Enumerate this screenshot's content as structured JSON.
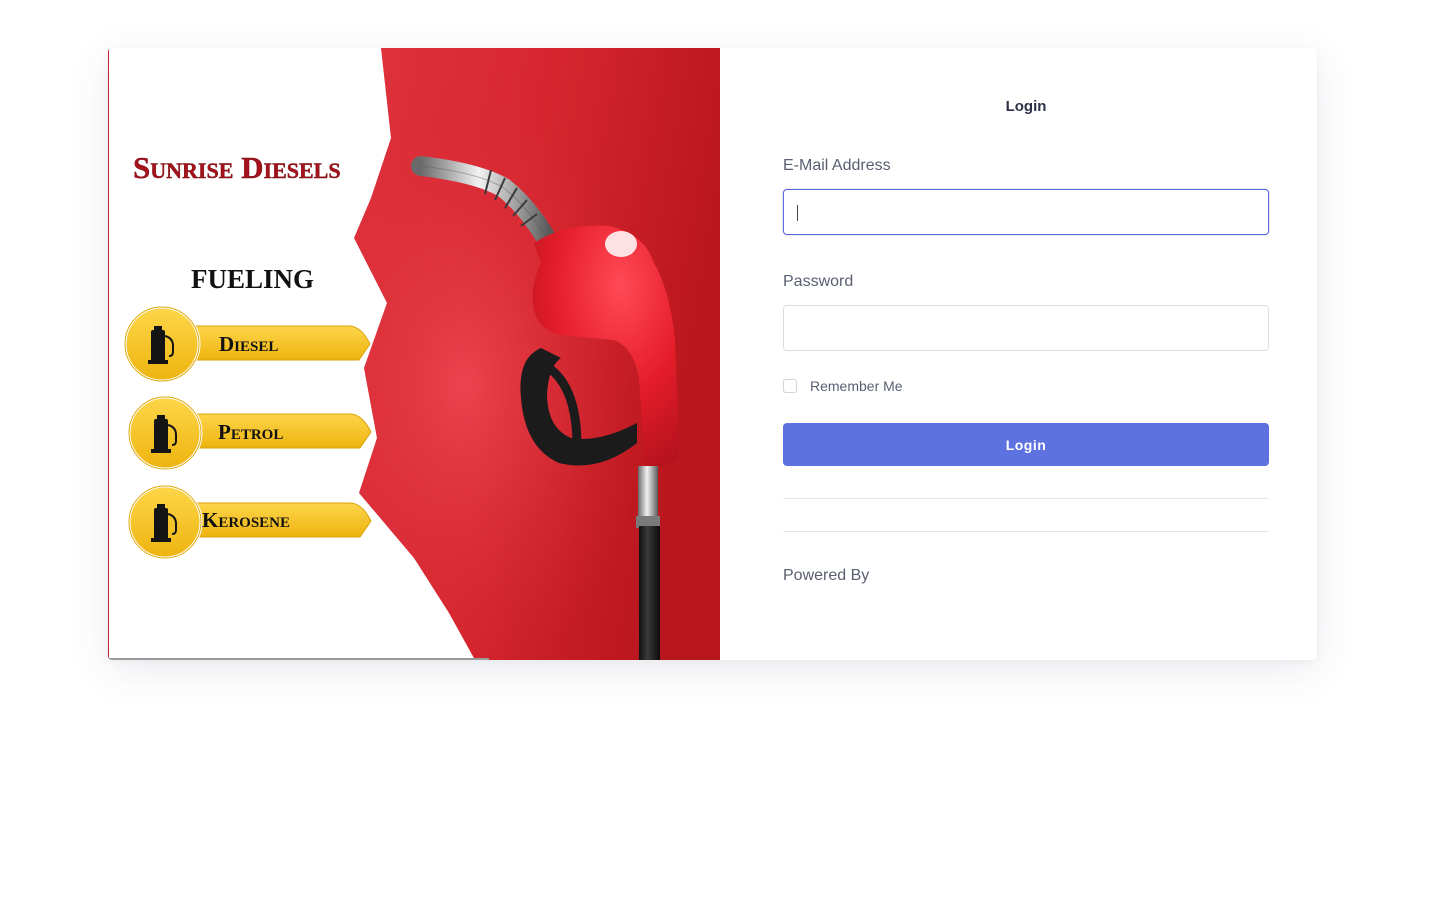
{
  "hero": {
    "brand": "Sunrise Diesels",
    "heading": "FUELING",
    "fuels": [
      "Diesel",
      "Petrol",
      "Kerosene"
    ],
    "colors": {
      "red": "#d42a33",
      "gold": "#f7c62c",
      "black": "#1c1c1c"
    },
    "icons": {
      "fuel": "fuel-pump-icon",
      "nozzle": "fuel-nozzle-icon"
    }
  },
  "form": {
    "title": "Login",
    "email_label": "E-Mail Address",
    "email_value": "",
    "password_label": "Password",
    "password_value": "",
    "remember_label": "Remember Me",
    "remember_checked": false,
    "login_button": "Login",
    "powered_by": "Powered By",
    "accent_color": "#5d72e0"
  }
}
